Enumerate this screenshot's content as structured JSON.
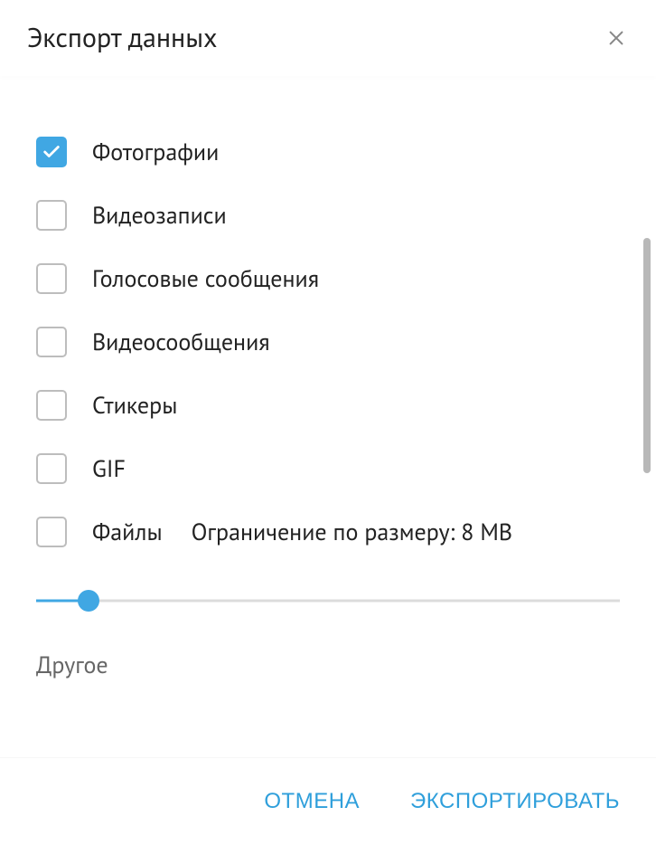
{
  "dialog": {
    "title": "Экспорт данных"
  },
  "options": {
    "photos": {
      "label": "Фотографии",
      "checked": true
    },
    "videos": {
      "label": "Видеозаписи",
      "checked": false
    },
    "voice": {
      "label": "Голосовые сообщения",
      "checked": false
    },
    "video_messages": {
      "label": "Видеосообщения",
      "checked": false
    },
    "stickers": {
      "label": "Стикеры",
      "checked": false
    },
    "gif": {
      "label": "GIF",
      "checked": false
    },
    "files": {
      "label": "Файлы",
      "checked": false,
      "size_limit_text": "Ограничение по размеру: 8 MB"
    }
  },
  "slider": {
    "value_percent": 9
  },
  "other_section_label": "Другое",
  "footer": {
    "cancel": "ОТМЕНА",
    "export": "ЭКСПОРТИРОВАТЬ"
  }
}
